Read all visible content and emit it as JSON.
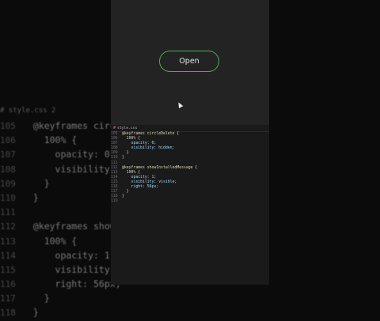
{
  "preview": {
    "open_label": "Open"
  },
  "editor": {
    "tab_label": "style.css"
  },
  "background_editor": {
    "tab_label": "# style.css 2",
    "lines": [
      {
        "no": "105",
        "code": "  @keyframes circle"
      },
      {
        "no": "106",
        "code": "    100% {"
      },
      {
        "no": "107",
        "code": "      opacity: 0;"
      },
      {
        "no": "108",
        "code": "      visibility: hi"
      },
      {
        "no": "109",
        "code": "    }"
      },
      {
        "no": "110",
        "code": "  }"
      },
      {
        "no": "111",
        "code": ""
      },
      {
        "no": "112",
        "code": "  @keyframes showIn"
      },
      {
        "no": "113",
        "code": "    100% {"
      },
      {
        "no": "114",
        "code": "      opacity: 1;"
      },
      {
        "no": "115",
        "code": "      visibility: v"
      },
      {
        "no": "116",
        "code": "      right: 56px;"
      },
      {
        "no": "117",
        "code": "    }"
      },
      {
        "no": "118",
        "code": "  }"
      }
    ]
  },
  "code_lines": [
    {
      "no": "105",
      "code": "@keyframes circleDelete {"
    },
    {
      "no": "106",
      "code": "  100% {"
    },
    {
      "no": "107",
      "code": "    opacity: 0;"
    },
    {
      "no": "108",
      "code": "    visibility: hidden;"
    },
    {
      "no": "109",
      "code": "  }"
    },
    {
      "no": "110",
      "code": "}"
    },
    {
      "no": "111",
      "code": ""
    },
    {
      "no": "112",
      "code": "@keyframes showInstalledMessage {"
    },
    {
      "no": "113",
      "code": "  100% {"
    },
    {
      "no": "114",
      "code": "    opacity: 1;"
    },
    {
      "no": "115",
      "code": "    visibility: visible;"
    },
    {
      "no": "116",
      "code": "    right: 56px;"
    },
    {
      "no": "117",
      "code": "  }"
    },
    {
      "no": "118",
      "code": "}"
    },
    {
      "no": "119",
      "code": ""
    }
  ],
  "colors": {
    "accent_green": "#4caf50",
    "keyword": "#c586c0",
    "property": "#9cdcfe",
    "value_string": "#ce9178",
    "value_number": "#b5cea8"
  }
}
